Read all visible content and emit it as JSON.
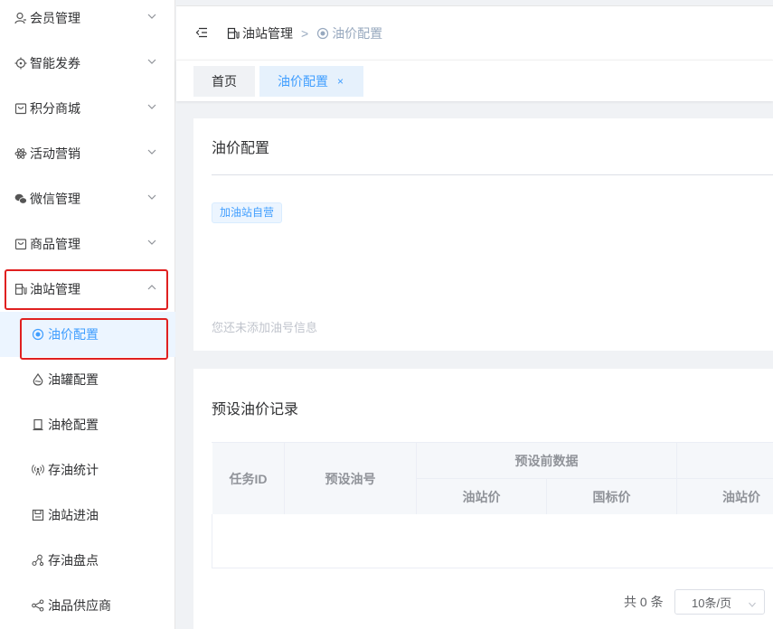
{
  "sidebar": {
    "items": [
      {
        "label": "会员管理",
        "icon": "user-icon"
      },
      {
        "label": "智能发券",
        "icon": "target-icon"
      },
      {
        "label": "积分商城",
        "icon": "shopping-bag-icon"
      },
      {
        "label": "活动营销",
        "icon": "atom-icon"
      },
      {
        "label": "微信管理",
        "icon": "wechat-icon"
      },
      {
        "label": "商品管理",
        "icon": "shopping-bag-icon"
      },
      {
        "label": "油站管理",
        "icon": "gas-station-icon"
      }
    ],
    "sub_items": [
      {
        "label": "油价配置",
        "icon": "radio-dot-icon",
        "active": true
      },
      {
        "label": "油罐配置",
        "icon": "drop-icon"
      },
      {
        "label": "油枪配置",
        "icon": "pump-icon"
      },
      {
        "label": "存油统计",
        "icon": "broadcast-icon"
      },
      {
        "label": "油站进油",
        "icon": "save-icon"
      },
      {
        "label": "存油盘点",
        "icon": "graph-icon"
      },
      {
        "label": "油品供应商",
        "icon": "share-icon"
      }
    ]
  },
  "breadcrumb": {
    "parent": "油站管理",
    "separator": ">",
    "current": "油价配置"
  },
  "tabs": {
    "home": "首页",
    "current": "油价配置",
    "close": "×"
  },
  "oil_price": {
    "title": "油价配置",
    "tag": "加油站自营",
    "empty": "您还未添加油号信息"
  },
  "records": {
    "title": "预设油价记录",
    "headers": {
      "task_id": "任务ID",
      "preset_oil": "预设油号",
      "before": "预设前数据",
      "station_price": "油站价",
      "national_price": "国标价",
      "station_price_2": "油站价"
    },
    "pagination": {
      "total": "共 0 条",
      "page_size": "10条/页"
    }
  },
  "colors": {
    "accent": "#409eff",
    "highlight": "#e02020"
  }
}
